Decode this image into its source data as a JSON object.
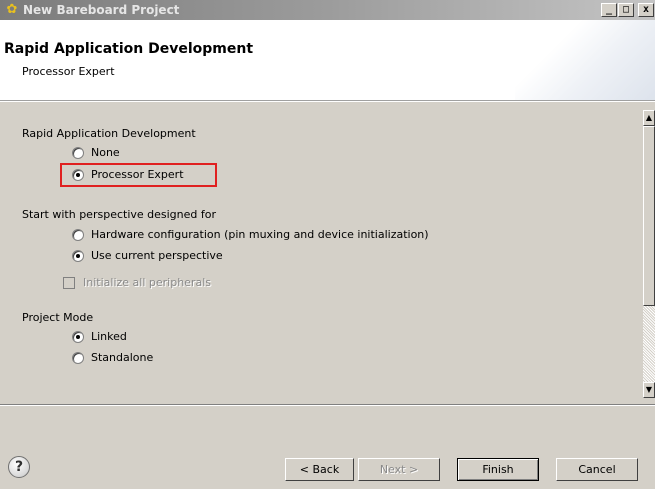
{
  "window": {
    "title": "New Bareboard Project",
    "controls": {
      "minimize": "_",
      "maximize": "□",
      "close": "x"
    }
  },
  "header": {
    "title": "Rapid Application Development",
    "subtitle": "Processor Expert"
  },
  "rad": {
    "label": "Rapid Application Development",
    "options": [
      {
        "label": "None",
        "checked": false
      },
      {
        "label": "Processor Expert",
        "checked": true
      }
    ]
  },
  "perspective": {
    "label": "Start with perspective designed for",
    "options": [
      {
        "label": "Hardware configuration (pin muxing and device initialization)",
        "checked": false
      },
      {
        "label": "Use current perspective",
        "checked": true
      }
    ],
    "init_peripherals": {
      "label": "Initialize all peripherals",
      "checked": false,
      "enabled": false
    }
  },
  "mode": {
    "label": "Project Mode",
    "options": [
      {
        "label": "Linked",
        "checked": true
      },
      {
        "label": "Standalone",
        "checked": false
      }
    ]
  },
  "footer": {
    "help": "?",
    "back": "< Back",
    "next": "Next >",
    "finish": "Finish",
    "cancel": "Cancel"
  },
  "colors": {
    "highlight": "#e02020"
  }
}
